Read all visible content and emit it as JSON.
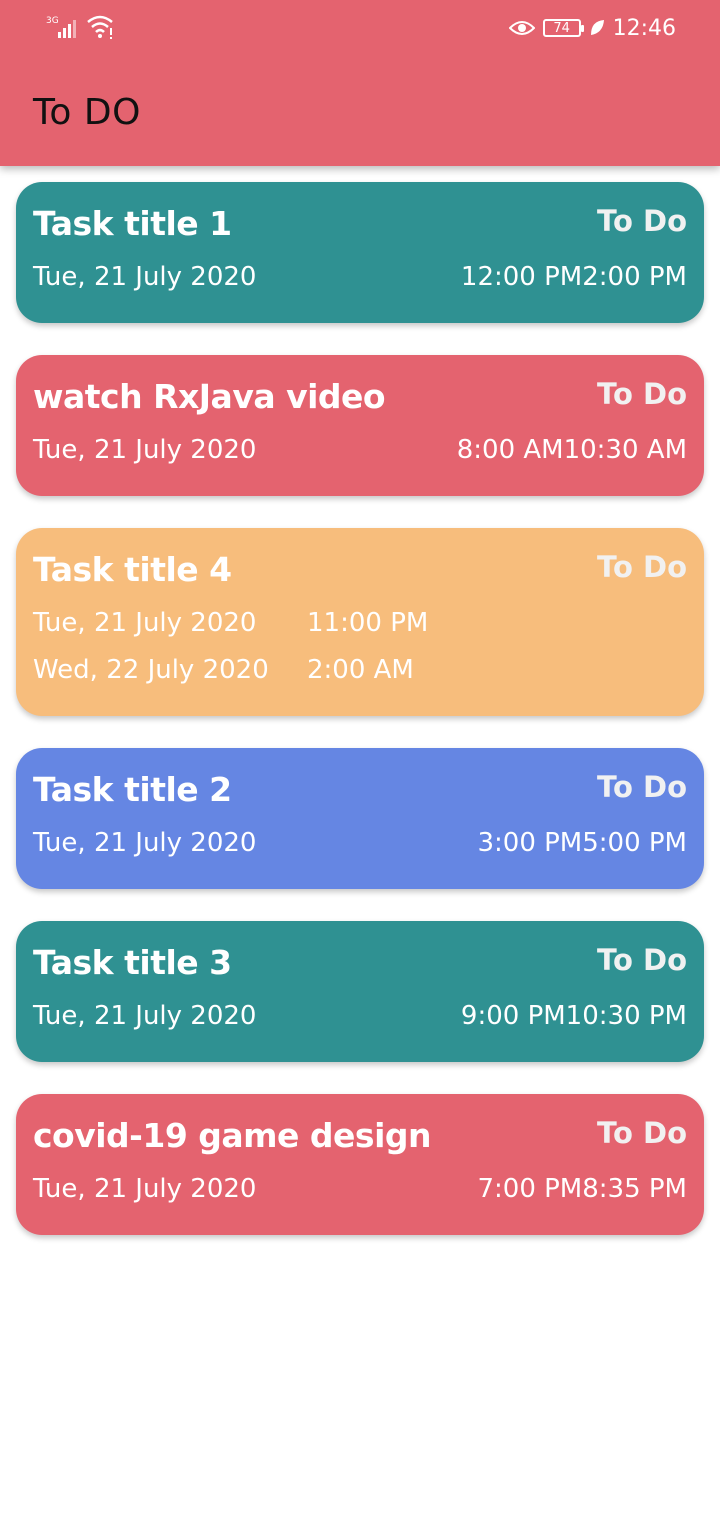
{
  "status_bar": {
    "network_label": "3G",
    "battery": "74",
    "time": "12:46",
    "icons": [
      "signal-icon",
      "wifi-icon",
      "eye-icon",
      "battery-icon",
      "leaf-icon"
    ]
  },
  "app_bar": {
    "title": "To DO",
    "color": "#e4636f"
  },
  "tasks": [
    {
      "title": "Task title 1",
      "status": "To Do",
      "date": "Tue, 21 July 2020",
      "time": "12:00 PM2:00 PM",
      "color": "#2f9192"
    },
    {
      "title": "watch RxJava video",
      "status": "To Do",
      "date": "Tue, 21 July 2020",
      "time": "8:00 AM10:30 AM",
      "color": "#e4636f"
    },
    {
      "title": "Task title 4",
      "status": "To Do",
      "start_date": "Tue, 21 July 2020",
      "start_time": "11:00 PM",
      "end_date": "Wed, 22 July 2020",
      "end_time": "2:00 AM",
      "color": "#f7bd7c"
    },
    {
      "title": "Task title 2",
      "status": "To Do",
      "date": "Tue, 21 July 2020",
      "time": "3:00 PM5:00 PM",
      "color": "#6586e3"
    },
    {
      "title": "Task title 3",
      "status": "To Do",
      "date": "Tue, 21 July 2020",
      "time": "9:00 PM10:30 PM",
      "color": "#2f9192"
    },
    {
      "title": "covid-19 game design",
      "status": "To Do",
      "date": "Tue, 21 July 2020",
      "time": "7:00 PM8:35 PM",
      "color": "#e4636f"
    }
  ]
}
